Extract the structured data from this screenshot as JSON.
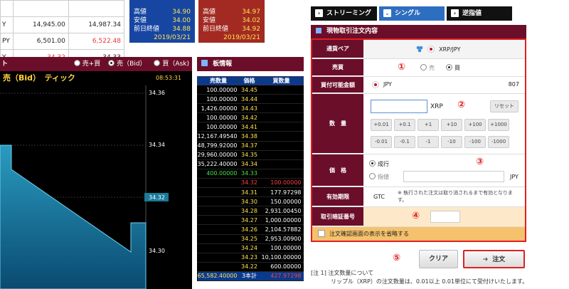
{
  "rates_table": {
    "rows": [
      {
        "label": "",
        "col1": "",
        "col2": ""
      },
      {
        "label": "Y",
        "col1": "14,945.00",
        "col2": "14,987.34",
        "col2_red": false
      },
      {
        "label": "PY",
        "col1": "6,501.00",
        "col2": "6,522.48",
        "col2_red": true
      },
      {
        "label": "Y",
        "col1": "34.32",
        "col2": "34.33",
        "col1_red": true
      }
    ]
  },
  "bid_box": {
    "rows": [
      {
        "label": "高値",
        "value": "34.90"
      },
      {
        "label": "安値",
        "value": "34.00"
      },
      {
        "label": "前日終値",
        "value": "34.88"
      }
    ],
    "date": "2019/03/21",
    "color": "#1746a2"
  },
  "ask_box": {
    "rows": [
      {
        "label": "高値",
        "value": "34.97"
      },
      {
        "label": "安値",
        "value": "34.02"
      },
      {
        "label": "前日終値",
        "value": "34.92"
      }
    ],
    "date": "2019/03/21",
    "color": "#a22a22"
  },
  "chart_header": {
    "title_fragment": "ト",
    "options": [
      "売+買",
      "売（Bid）",
      "買（Ask)"
    ],
    "selected": 1
  },
  "chart": {
    "title": "売（Bid）　ティック",
    "time": "08:53:31",
    "price_labels": [
      "34.36",
      "34.34",
      "34.32",
      "34.30"
    ],
    "current_price": "34.32"
  },
  "board": {
    "title": "板情報",
    "headers": [
      "売数量",
      "価格",
      "買数量"
    ],
    "ask_rows": [
      {
        "sell": "100.00000",
        "price": "34.45"
      },
      {
        "sell": "100.00000",
        "price": "34.44"
      },
      {
        "sell": "1,426.00000",
        "price": "34.43"
      },
      {
        "sell": "100.00000",
        "price": "34.42"
      },
      {
        "sell": "100.00000",
        "price": "34.41"
      },
      {
        "sell": "12,167.49540",
        "price": "34.38"
      },
      {
        "sell": "48,799.92000",
        "price": "34.37"
      },
      {
        "sell": "29,960.00000",
        "price": "34.35"
      },
      {
        "sell": "35,222.40000",
        "price": "34.34"
      },
      {
        "sell": "400.00000",
        "price": "34.33",
        "green": true
      }
    ],
    "bid_rows": [
      {
        "price": "34.32",
        "buy": "100.00000",
        "red": true
      },
      {
        "price": "34.31",
        "buy": "177.97298"
      },
      {
        "price": "34.30",
        "buy": "150.00000"
      },
      {
        "price": "34.28",
        "buy": "2,931.00450"
      },
      {
        "price": "34.27",
        "buy": "1,000.00000"
      },
      {
        "price": "34.26",
        "buy": "2,104.57882"
      },
      {
        "price": "34.25",
        "buy": "2,953.00900"
      },
      {
        "price": "34.24",
        "buy": "100.00000"
      },
      {
        "price": "34.23",
        "buy": "10,100.00000"
      },
      {
        "price": "34.22",
        "buy": "600.00000"
      }
    ],
    "footer": {
      "sell": "65,582.40000",
      "price": "3本計",
      "buy": "427.97298"
    }
  },
  "tabs": [
    {
      "label": "ストリーミング",
      "active": false
    },
    {
      "label": "シングル",
      "active": true
    },
    {
      "label": "逆指値",
      "active": false
    }
  ],
  "order": {
    "title": "現物取引注文内容",
    "pair_label": "通貨ペア",
    "pair_value": "XRP/JPY",
    "side_label": "売買",
    "side_options": [
      "売",
      "買"
    ],
    "side_selected": 1,
    "available_label": "買付可能金額",
    "available_currency": "JPY",
    "available_amount": "807",
    "qty_label": "数　量",
    "qty_unit": "XRP",
    "qty_value": "",
    "reset_label": "リセット",
    "qty_buttons_plus": [
      "+0.01",
      "+0.1",
      "+1",
      "+10",
      "+100",
      "+1000"
    ],
    "qty_buttons_minus": [
      "-0.01",
      "-0.1",
      "-1",
      "-10",
      "-100",
      "-1000"
    ],
    "price_label": "価　格",
    "price_options": [
      "成行",
      "指値"
    ],
    "price_selected": 0,
    "price_unit": "JPY",
    "validity_label": "有効期限",
    "validity_value": "GTC",
    "validity_note": "※ 執行された注文は取り消されるまで有効となります。",
    "pin_label": "取引暗証番号",
    "skip_confirm_label": "注文確認画面の表示を省略する",
    "markers": [
      "①",
      "②",
      "③",
      "④",
      "⑤"
    ]
  },
  "actions": {
    "clear_label": "クリア",
    "order_label": "注文"
  },
  "note": {
    "line1": "[注 1]  注文数量について",
    "line2": "リップル（XRP）の注文数量は、0.01以上 0.01単位にて受付けいたします。"
  }
}
